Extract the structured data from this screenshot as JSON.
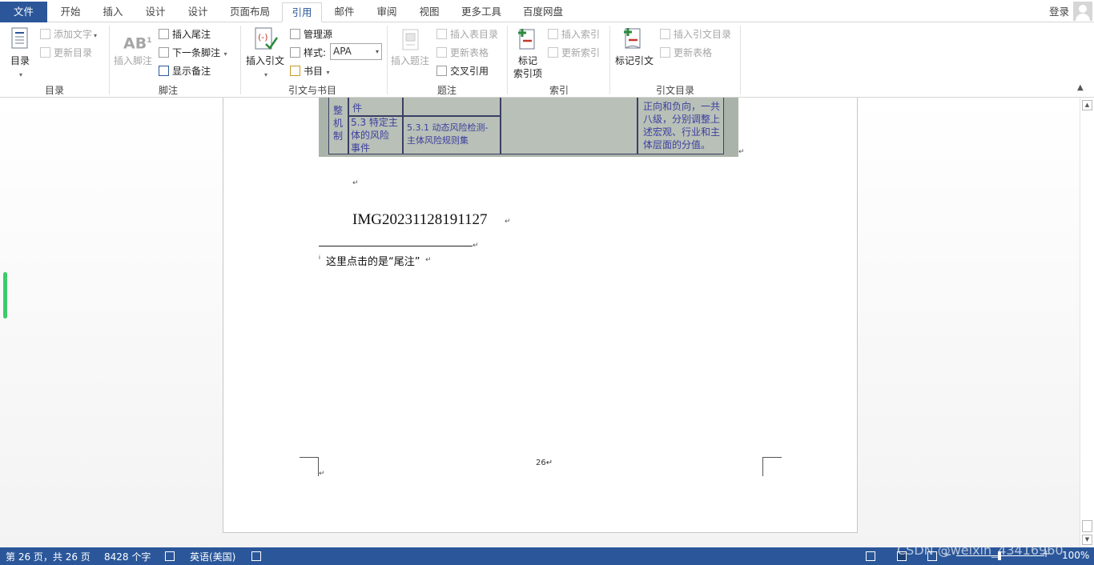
{
  "tabs": [
    "文件",
    "开始",
    "插入",
    "设计",
    "设计",
    "页面布局",
    "引用",
    "邮件",
    "审阅",
    "视图",
    "更多工具",
    "百度网盘"
  ],
  "login_label": "登录",
  "ribbon": {
    "toc": {
      "toc_btn": "目录",
      "add_text": "添加文字",
      "update_toc": "更新目录",
      "group": "目录"
    },
    "footnote": {
      "insert_footnote": "插入脚注",
      "insert_endnote": "插入尾注",
      "next_footnote": "下一条脚注",
      "show_notes": "显示备注",
      "group": "脚注"
    },
    "citation": {
      "insert_citation": "插入引文",
      "manage_sources": "管理源",
      "style_label": "样式:",
      "style_value": "APA",
      "bibliography": "书目",
      "group": "引文与书目"
    },
    "caption": {
      "insert_caption": "插入题注",
      "insert_table_of_figures": "插入表目录",
      "update_table": "更新表格",
      "cross_reference": "交叉引用",
      "group": "题注"
    },
    "index": {
      "mark_entry_line1": "标记",
      "mark_entry_line2": "索引项",
      "insert_index": "插入索引",
      "update_index": "更新索引",
      "group": "索引"
    },
    "authorities": {
      "mark_citation": "标记引文",
      "insert_toa": "插入引文目录",
      "update_table": "更新表格",
      "group": "引文目录"
    }
  },
  "document": {
    "scan_cells": {
      "c1": "整\n机\n制",
      "c2a": "件",
      "c2b": "5.3 特定主\n体的风险\n事件",
      "c3": "5.3.1 动态风险检测-\n主体风险规则集",
      "c5": "正向和负向，一共\n八级，分别调整上\n述宏观、行业和主\n体层面的分值。"
    },
    "caption_text": "IMG20231128191127",
    "footnote_mark": "i",
    "footnote_text": "这里点击的是“尾注”",
    "page_number": "26",
    "paragraph_mark": "↵"
  },
  "status": {
    "page": "第 26 页，共 26 页",
    "words": "8428 个字",
    "language": "英语(美国)",
    "zoom": "100%",
    "watermark": "CSDN @weixin_43416960"
  },
  "colors": {
    "brand": "#2b579a",
    "accent_bar": "#3ccc6a"
  }
}
